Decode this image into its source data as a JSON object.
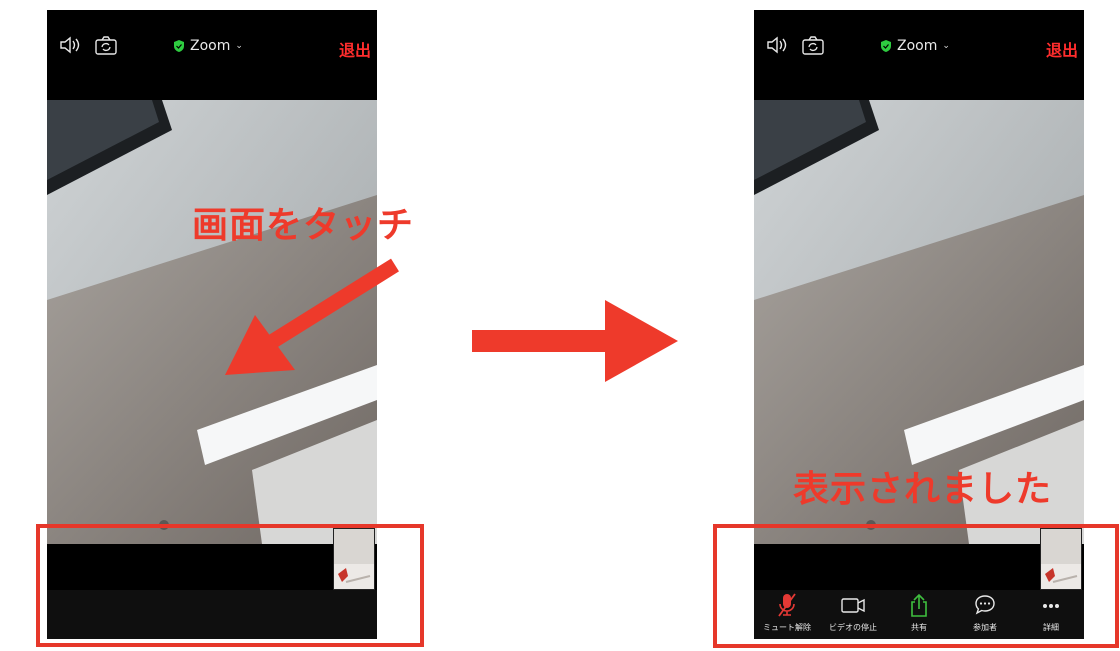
{
  "left_phone": {
    "title": "Zoom",
    "leave_label": "退出"
  },
  "right_phone": {
    "title": "Zoom",
    "leave_label": "退出",
    "toolbar": [
      {
        "label": "ミュート解除",
        "icon": "muted-mic-icon"
      },
      {
        "label": "ビデオの停止",
        "icon": "video-camera-icon"
      },
      {
        "label": "共有",
        "icon": "share-icon"
      },
      {
        "label": "参加者",
        "icon": "chat-bubble-icon"
      },
      {
        "label": "詳細",
        "icon": "more-icon"
      }
    ]
  },
  "annotations": {
    "touch_screen": "画面をタッチ",
    "displayed": "表示されました"
  },
  "colors": {
    "annotation_red": "#ee3a2b",
    "leave_red": "#ff2d2d",
    "shield_green": "#2ecc40",
    "share_green": "#3fbf3f",
    "mute_red": "#e53935"
  }
}
